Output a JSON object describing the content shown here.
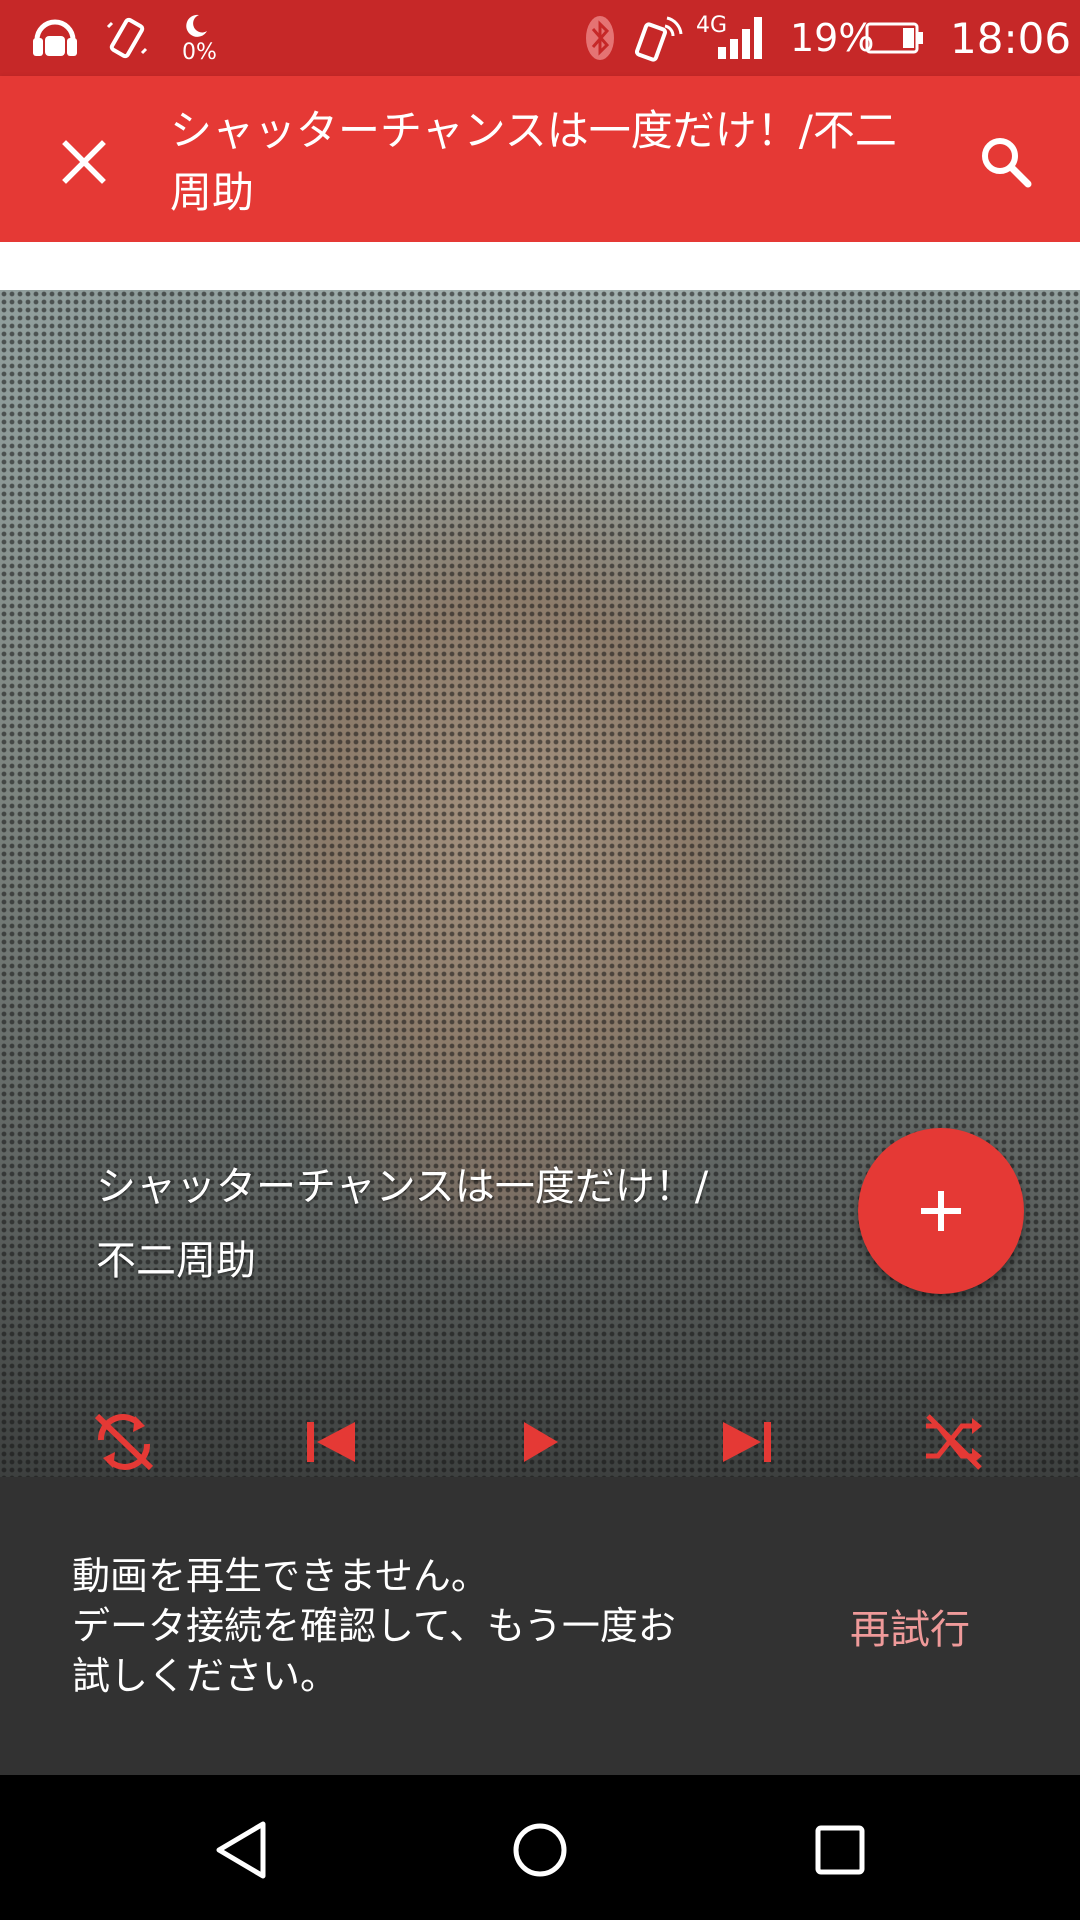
{
  "status_bar": {
    "battery": "19%",
    "time": "18:06",
    "network": "4G",
    "moon_percent": "0%",
    "icons": [
      "headphone-app-icon",
      "vibrate-icon",
      "moon-icon",
      "bluetooth-icon",
      "nfc-icon",
      "signal-icon",
      "battery-icon"
    ]
  },
  "app_bar": {
    "title": "シャッターチャンスは一度だけ！/不二周助",
    "close_icon": "close-icon",
    "search_icon": "search-icon"
  },
  "player": {
    "song_title": "シャッターチャンスは一度だけ！/\n不二周助",
    "fab_icon": "plus-icon",
    "controls": [
      "repeat-off-icon",
      "skip-previous-icon",
      "play-icon",
      "skip-next-icon",
      "shuffle-off-icon"
    ]
  },
  "snackbar": {
    "message": "動画を再生できません。\nデータ接続を確認して、もう一度お\n試しください。",
    "action": "再試行"
  },
  "nav_bar": {
    "buttons": [
      "back-icon",
      "home-icon",
      "recents-icon"
    ]
  },
  "colors": {
    "status_bar": "#c62828",
    "primary": "#e53935",
    "snackbar": "#323232",
    "snackbar_action": "#ef9a9a"
  }
}
